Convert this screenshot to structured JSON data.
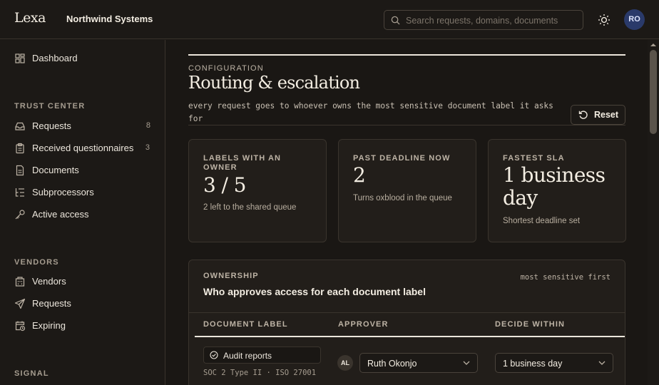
{
  "app": {
    "logo": "Lexa",
    "org_name": "Northwind Systems"
  },
  "header": {
    "search": {
      "placeholder": "Search requests, domains, documents",
      "value": ""
    },
    "avatar_initials": "RO",
    "icons": [
      "search-icon",
      "sun-icon"
    ]
  },
  "sidebar": {
    "dashboard": {
      "label": "Dashboard",
      "icon": "grid-icon"
    },
    "trust_center": {
      "title": "TRUST CENTER",
      "items": [
        {
          "label": "Requests",
          "count": "8",
          "icon": "inbox-icon"
        },
        {
          "label": "Received questionnaires",
          "count": "3",
          "icon": "clipboard-icon"
        },
        {
          "label": "Documents",
          "count": "",
          "icon": "document-icon"
        },
        {
          "label": "Subprocessors",
          "count": "",
          "icon": "list-tree-icon"
        },
        {
          "label": "Active access",
          "count": "",
          "icon": "key-icon"
        }
      ]
    },
    "vendors": {
      "title": "VENDORS",
      "items": [
        {
          "label": "Vendors",
          "icon": "building-icon"
        },
        {
          "label": "Requests",
          "icon": "send-icon"
        },
        {
          "label": "Expiring",
          "icon": "calendar-clock-icon"
        }
      ]
    },
    "signal": {
      "title": "SIGNAL"
    }
  },
  "page": {
    "eyebrow": "CONFIGURATION",
    "title": "Routing & escalation",
    "description": "every request goes to whoever owns the most sensitive document label it asks for",
    "reset_label": "Reset"
  },
  "stats": [
    {
      "label": "LABELS WITH AN OWNER",
      "value": "3 / 5",
      "sub": "2 left to the shared queue"
    },
    {
      "label": "PAST DEADLINE NOW",
      "value": "2",
      "sub": "Turns oxblood in the queue"
    },
    {
      "label": "FASTEST SLA",
      "value": "1 business day",
      "sub": "Shortest deadline set"
    }
  ],
  "ownership": {
    "eyebrow": "OWNERSHIP",
    "title": "Who approves access for each document label",
    "sort_hint": "most sensitive first",
    "columns": [
      "DOCUMENT LABEL",
      "APPROVER",
      "DECIDE WITHIN"
    ],
    "rows": [
      {
        "label": "Audit reports",
        "sub": "SOC 2 Type II · ISO 27001",
        "approver_initials": "AL",
        "approver": "Ruth Okonjo",
        "decide_within": "1 business day"
      }
    ]
  },
  "colors": {
    "background": "#1a1714",
    "text": "#ece6dc",
    "border": "#3a342d",
    "avatar": "#2a3a6a"
  }
}
